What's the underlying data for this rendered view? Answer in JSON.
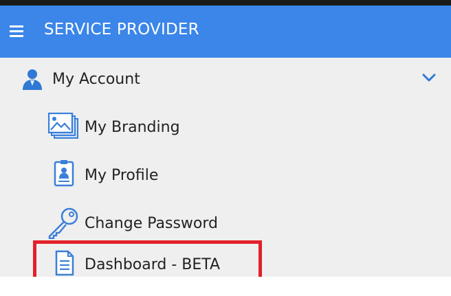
{
  "header": {
    "title": "SERVICE PROVIDER",
    "menu_icon": "hamburger-menu-icon"
  },
  "menu": {
    "section": {
      "label": "My Account",
      "icon": "user-icon",
      "expand_icon": "chevron-down-icon"
    },
    "items": [
      {
        "label": "My Branding",
        "icon": "image-gallery-icon"
      },
      {
        "label": "My Profile",
        "icon": "id-badge-icon"
      },
      {
        "label": "Change Password",
        "icon": "key-icon"
      },
      {
        "label": "Dashboard - BETA",
        "icon": "document-icon",
        "highlighted": true
      }
    ]
  },
  "colors": {
    "header_bg": "#3b86e8",
    "panel_bg": "#efefef",
    "icon_blue": "#3a7fd8",
    "highlight_border": "#e3202a"
  }
}
